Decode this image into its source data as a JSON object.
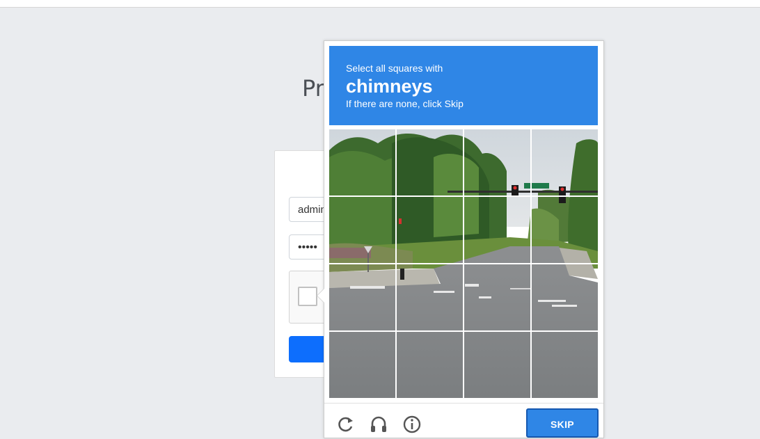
{
  "page": {
    "title": "Pr"
  },
  "login": {
    "username_value": "admin",
    "password_value": "•••••"
  },
  "captcha": {
    "instruction": "Select all squares with",
    "keyword": "chimneys",
    "hint": "If there are none, click Skip",
    "grid_size": "4x4",
    "image_subject": "street intersection with traffic lights",
    "tile_count": 16,
    "buttons": {
      "skip": "SKIP"
    },
    "icons": [
      "reload-icon",
      "audio-icon",
      "info-icon"
    ],
    "colors": {
      "header": "#2f86e6",
      "skip_button": "#2f86e6"
    }
  }
}
